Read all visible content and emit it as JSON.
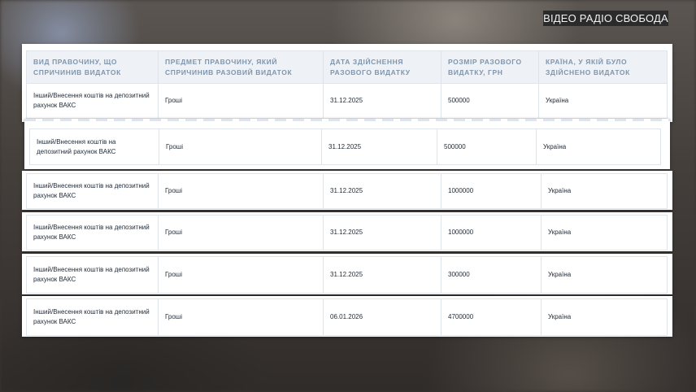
{
  "overlay": {
    "logo": "ВІДЕО РАДІО СВОБОДА"
  },
  "table": {
    "headers": [
      "Вид правочину, що спричинив видаток",
      "Предмет правочину, який спричинив разовий видаток",
      "Дата здійснення разового видатку",
      "Розмір разового видатку, грн",
      "Країна, у якій було здійснено видаток"
    ],
    "rows": [
      [
        "Інший/Внесення коштів на депозитний рахунок ВАКС",
        "Гроші",
        "31.12.2025",
        "500000",
        "Україна"
      ],
      [
        "Інший/Внесення коштів на депозитний рахунок ВАКС",
        "Гроші",
        "31.12.2025",
        "500000",
        "Україна"
      ],
      [
        "Інший/Внесення коштів на депозитний рахунок ВАКС",
        "Гроші",
        "31.12.2025",
        "1000000",
        "Україна"
      ],
      [
        "Інший/Внесення коштів на депозитний рахунок ВАКС",
        "Гроші",
        "31.12.2025",
        "1000000",
        "Україна"
      ],
      [
        "Інший/Внесення коштів на депозитний рахунок ВАКС",
        "Гроші",
        "31.12.2025",
        "300000",
        "Україна"
      ],
      [
        "Інший/Внесення коштів на депозитний рахунок ВАКС",
        "Гроші",
        "06.01.2026",
        "4700000",
        "Україна"
      ]
    ]
  }
}
